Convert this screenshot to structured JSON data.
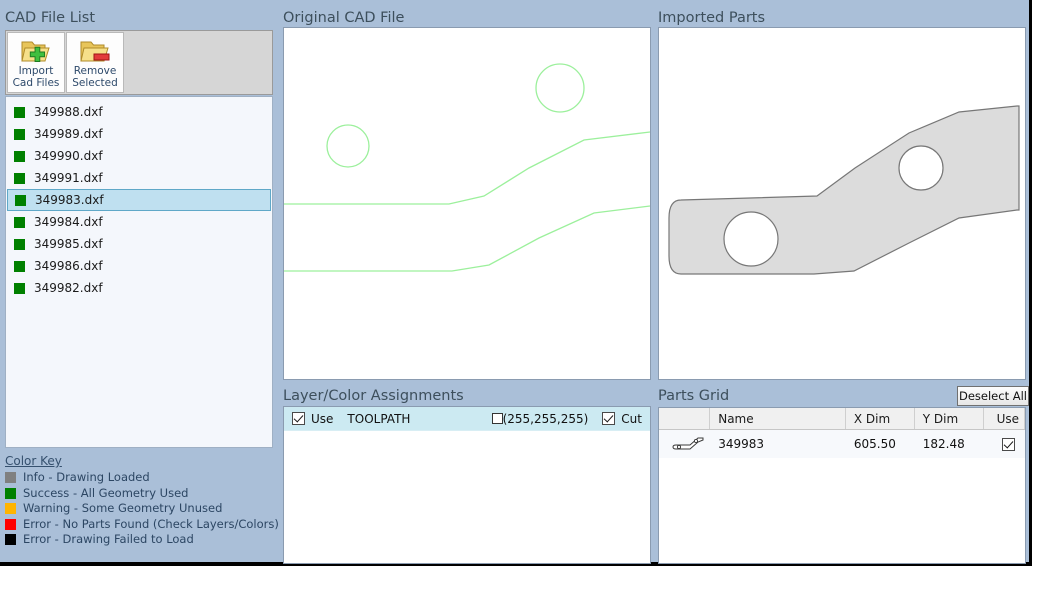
{
  "panels": {
    "cad_file_list": "CAD File List",
    "original_cad_file": "Original CAD File",
    "imported_parts": "Imported Parts",
    "layer_color_assignments": "Layer/Color Assignments",
    "parts_grid": "Parts Grid"
  },
  "toolbar": {
    "import": {
      "line1": "Import",
      "line2": "Cad Files",
      "icon": "folder-add-icon"
    },
    "remove": {
      "line1": "Remove",
      "line2": "Selected",
      "icon": "folder-remove-icon"
    }
  },
  "files": [
    {
      "name": "349988.dxf",
      "status_color": "#008000",
      "selected": false
    },
    {
      "name": "349989.dxf",
      "status_color": "#008000",
      "selected": false
    },
    {
      "name": "349990.dxf",
      "status_color": "#008000",
      "selected": false
    },
    {
      "name": "349991.dxf",
      "status_color": "#008000",
      "selected": false
    },
    {
      "name": "349983.dxf",
      "status_color": "#008000",
      "selected": true
    },
    {
      "name": "349984.dxf",
      "status_color": "#008000",
      "selected": false
    },
    {
      "name": "349985.dxf",
      "status_color": "#008000",
      "selected": false
    },
    {
      "name": "349986.dxf",
      "status_color": "#008000",
      "selected": false
    },
    {
      "name": "349982.dxf",
      "status_color": "#008000",
      "selected": false
    }
  ],
  "color_key": {
    "title": "Color Key",
    "entries": [
      {
        "color": "#808080",
        "label": "Info - Drawing Loaded"
      },
      {
        "color": "#008000",
        "label": "Success - All Geometry Used"
      },
      {
        "color": "#ffb400",
        "label": "Warning - Some Geometry Unused"
      },
      {
        "color": "#ff0000",
        "label": "Error - No Parts Found (Check Layers/Colors)"
      },
      {
        "color": "#000000",
        "label": "Error - Drawing Failed to Load"
      }
    ]
  },
  "layer_assignments": {
    "rows": [
      {
        "use_label": "Use",
        "use_checked": true,
        "layer_name": "TOOLPATH",
        "color_value": "(255,255,255)",
        "color_hex": "#ffffff",
        "cut_label": "Cut",
        "cut_checked": true
      }
    ]
  },
  "parts_grid": {
    "deselect_all_label": "Deselect All",
    "columns": [
      "",
      "Name",
      "X Dim",
      "Y Dim",
      "Use"
    ],
    "rows": [
      {
        "thumbnail": "part-outline-icon",
        "name": "349983",
        "x_dim": "605.50",
        "y_dim": "182.48",
        "use_checked": true
      }
    ]
  },
  "previews": {
    "cad_line_color": "#9cf09c",
    "part_fill_color": "#dcdcdc",
    "part_stroke_color": "#777777"
  }
}
